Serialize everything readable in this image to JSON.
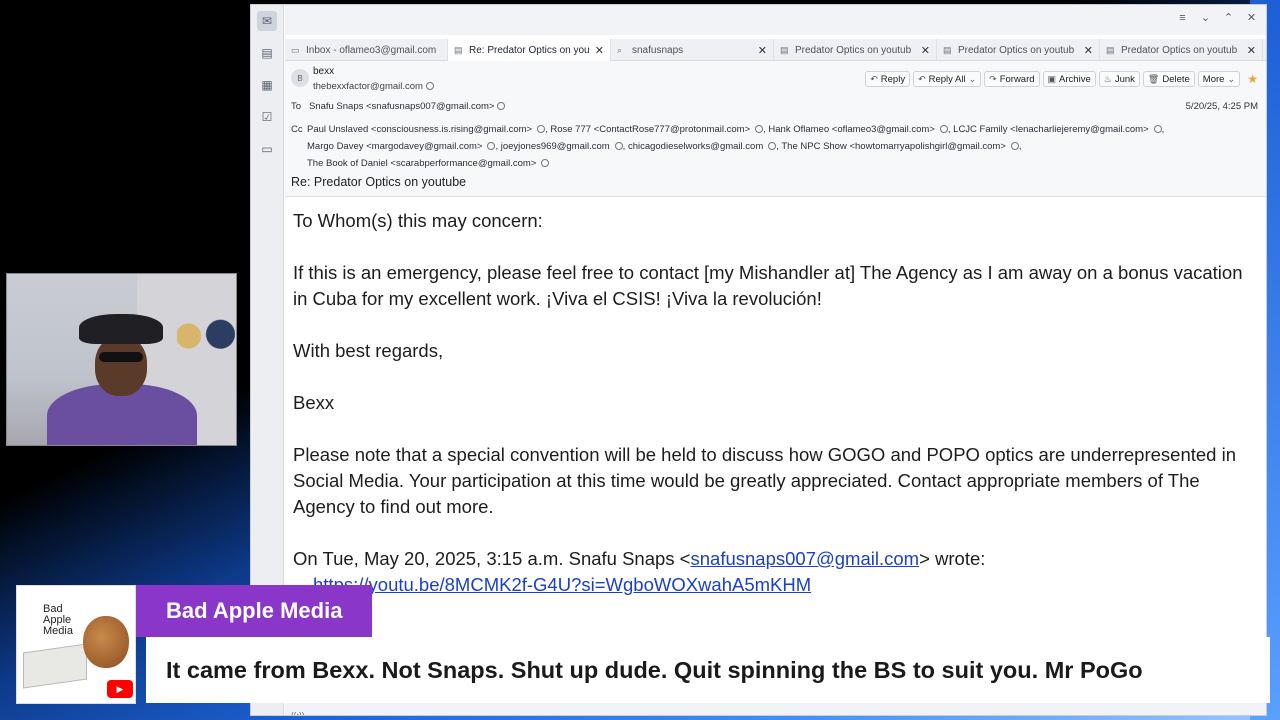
{
  "window": {
    "tabs": [
      {
        "label": "Inbox - oflameo3@gmail.com",
        "icon": "inbox-icon",
        "active": false
      },
      {
        "label": "Re: Predator Optics on you",
        "icon": "message-icon",
        "active": true
      },
      {
        "label": "snafusnaps",
        "icon": "search-icon",
        "active": false
      },
      {
        "label": "Predator Optics on youtub",
        "icon": "message-icon",
        "active": false
      },
      {
        "label": "Predator Optics on youtub",
        "icon": "message-icon",
        "active": false
      },
      {
        "label": "Predator Optics on youtub",
        "icon": "message-icon",
        "active": false
      }
    ]
  },
  "header": {
    "avatar_initial": "B",
    "from_name": "bexx",
    "from_email": "thebexxfactor@gmail.com",
    "actions": {
      "reply": "Reply",
      "reply_all": "Reply All",
      "forward": "Forward",
      "archive": "Archive",
      "junk": "Junk",
      "delete": "Delete",
      "more": "More"
    },
    "to_label": "To",
    "to_value": "Snafu Snaps <snafusnaps007@gmail.com>",
    "date": "5/20/25, 4:25 PM",
    "cc_label": "Cc",
    "cc": [
      "Paul Unslaved <consciousness.is.rising@gmail.com>",
      "Rose 777 <ContactRose777@protonmail.com>",
      "Hank Oflameo <oflameo3@gmail.com>",
      "LCJC Family <lenacharliejeremy@gmail.com>",
      "Margo Davey <margodavey@gmail.com>",
      "joeyjones969@gmail.com",
      "chicagodieselworks@gmail.com",
      "The NPC Show <howtomarryapolishgirl@gmail.com>",
      "The Book of Daniel <scarabperformance@gmail.com>"
    ],
    "subject": "Re: Predator Optics on youtube"
  },
  "body": {
    "greeting": "To Whom(s) this may concern:",
    "para1": "If this is an emergency, please feel free to contact [my Mishandler at] The Agency as I am away on a bonus vacation in Cuba for my excellent work. ¡Viva el CSIS! ¡Viva la revolución!",
    "closing": "With best regards,",
    "signature": "Bexx",
    "para2": "Please note that a special convention will be held to discuss how GOGO and POPO optics are underrepresented in Social Media. Your participation at this time would be greatly appreciated. Contact appropriate members of The Agency to find out more.",
    "quote_prefix": "On Tue, May 20, 2025, 3:15 a.m. Snafu Snaps <",
    "quote_email": "snafusnaps007@gmail.com",
    "quote_suffix": "> wrote:",
    "quote_link": "https://youtu.be/8MCMK2f-G4U?si=WgboWOXwahA5mKHM"
  },
  "overlay": {
    "logo_line1": "Bad",
    "logo_line2": "Apple",
    "logo_line3": "Media",
    "brand": "Bad Apple Media",
    "caption": "It came from Bexx. Not Snaps. Shut up dude. Quit spinning the BS to suit you. Mr PoGo",
    "colors": {
      "brand_bg": "#8a37c9",
      "youtube": "#ff0000"
    }
  }
}
